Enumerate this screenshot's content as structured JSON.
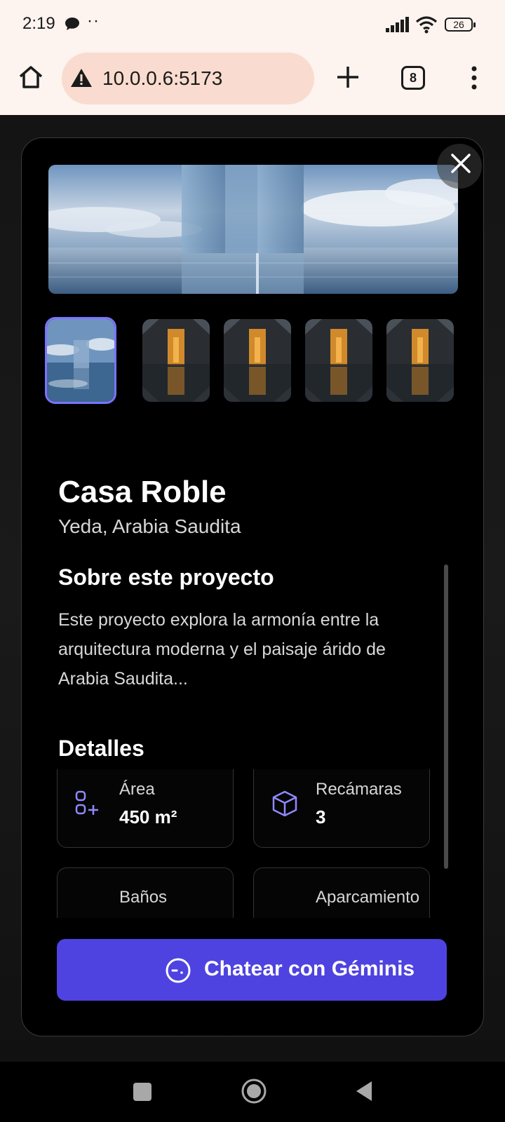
{
  "status_bar": {
    "time": "2:19",
    "dots": "··",
    "battery": "26"
  },
  "browser": {
    "url": "10.0.0.6:5173",
    "tab_count": "8"
  },
  "modal": {
    "gallery": {
      "thumbnails": [
        "mirror-cube",
        "dark-house",
        "dark-house",
        "dark-house",
        "dark-house"
      ],
      "selected_index": 0
    },
    "project": {
      "title": "Casa Roble",
      "location": "Yeda, Arabia Saudita"
    },
    "about": {
      "heading": "Sobre este proyecto",
      "body": "Este proyecto explora la armonía entre la arquitectura moderna y el paisaje árido de Arabia Saudita..."
    },
    "details": {
      "heading": "Detalles",
      "items": [
        {
          "label": "Área",
          "value": "450 m²",
          "icon": "area-icon"
        },
        {
          "label": "Recámaras",
          "value": "3",
          "icon": "cube-icon"
        },
        {
          "label": "Baños",
          "value": "",
          "icon": "bath-icon"
        },
        {
          "label": "Aparcamiento",
          "value": "",
          "icon": "parking-icon"
        }
      ]
    },
    "chat_button": {
      "label": "Chatear con Géminis"
    }
  },
  "colors": {
    "accent": "#4e43e0",
    "selected_outline": "#7b73ff",
    "icon_tint": "#8f89ff",
    "chrome_bg": "#fdf3ef",
    "url_pill_bg": "#f9dccf"
  }
}
